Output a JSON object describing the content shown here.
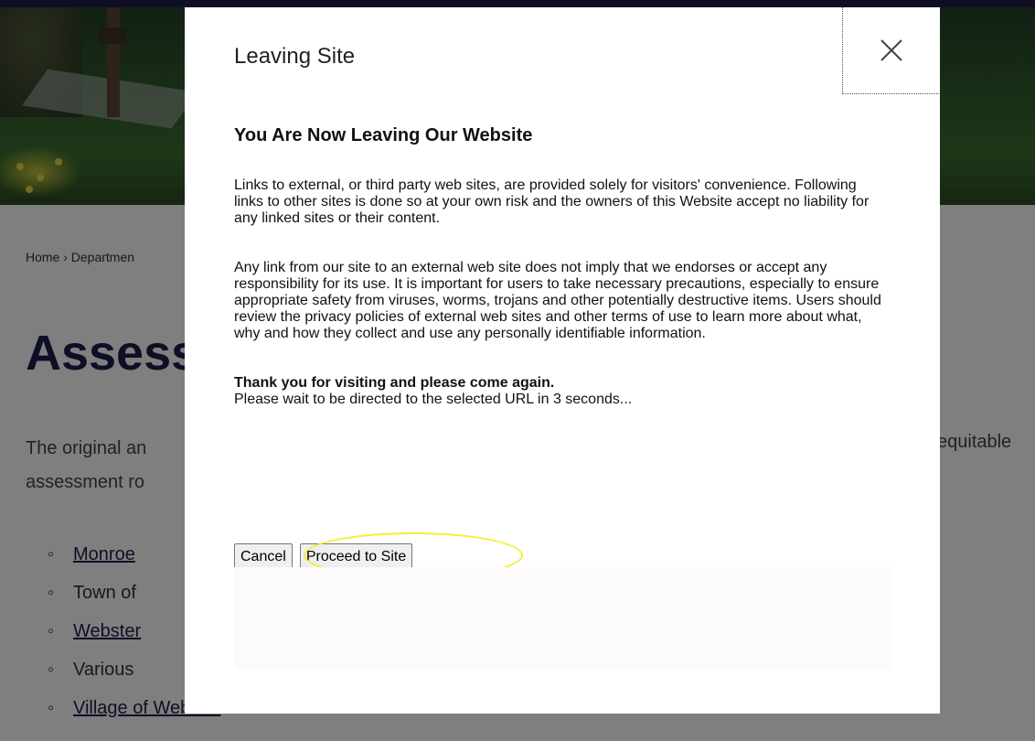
{
  "page": {
    "breadcrumb": "Home › Departmen",
    "title": "Assess",
    "intro_line1": "The original an",
    "intro_line2": "assessment ro",
    "intro_right": "equitable",
    "links": [
      {
        "label": "Monroe",
        "is_link": true
      },
      {
        "label": "Town of",
        "is_link": false
      },
      {
        "label": "Webster",
        "is_link": true
      },
      {
        "label": "Various",
        "is_link": false
      },
      {
        "label": "Village of Webster",
        "is_link": true
      }
    ]
  },
  "modal": {
    "title": "Leaving Site",
    "close_icon": "close-icon",
    "heading": "You Are Now Leaving Our Website",
    "paragraph1": "Links to external, or third party web sites, are provided solely for visitors' convenience. Following links to other sites is done so at your own risk and the owners of this Website accept no liability for any linked sites or their content.",
    "paragraph2": "Any link from our site to an external web site does not imply that we endorses or accept any responsibility for its use. It is important for users to take necessary precautions, especially to ensure appropriate safety from viruses, worms, trojans and other potentially destructive items. Users should review the privacy policies of external web sites and other terms of use to learn more about what, why and how they collect and use any personally identifiable information.",
    "thanks": "Thank you for visiting and please come again.",
    "redirect_note": "Please wait to be directed to the selected URL in 3 seconds...",
    "cancel_label": "Cancel",
    "proceed_label": "Proceed to Site"
  },
  "colors": {
    "overlay": "rgba(0,0,0,0.5)",
    "brand_navy": "#1d1f4a",
    "highlight": "#f4ef2a"
  }
}
